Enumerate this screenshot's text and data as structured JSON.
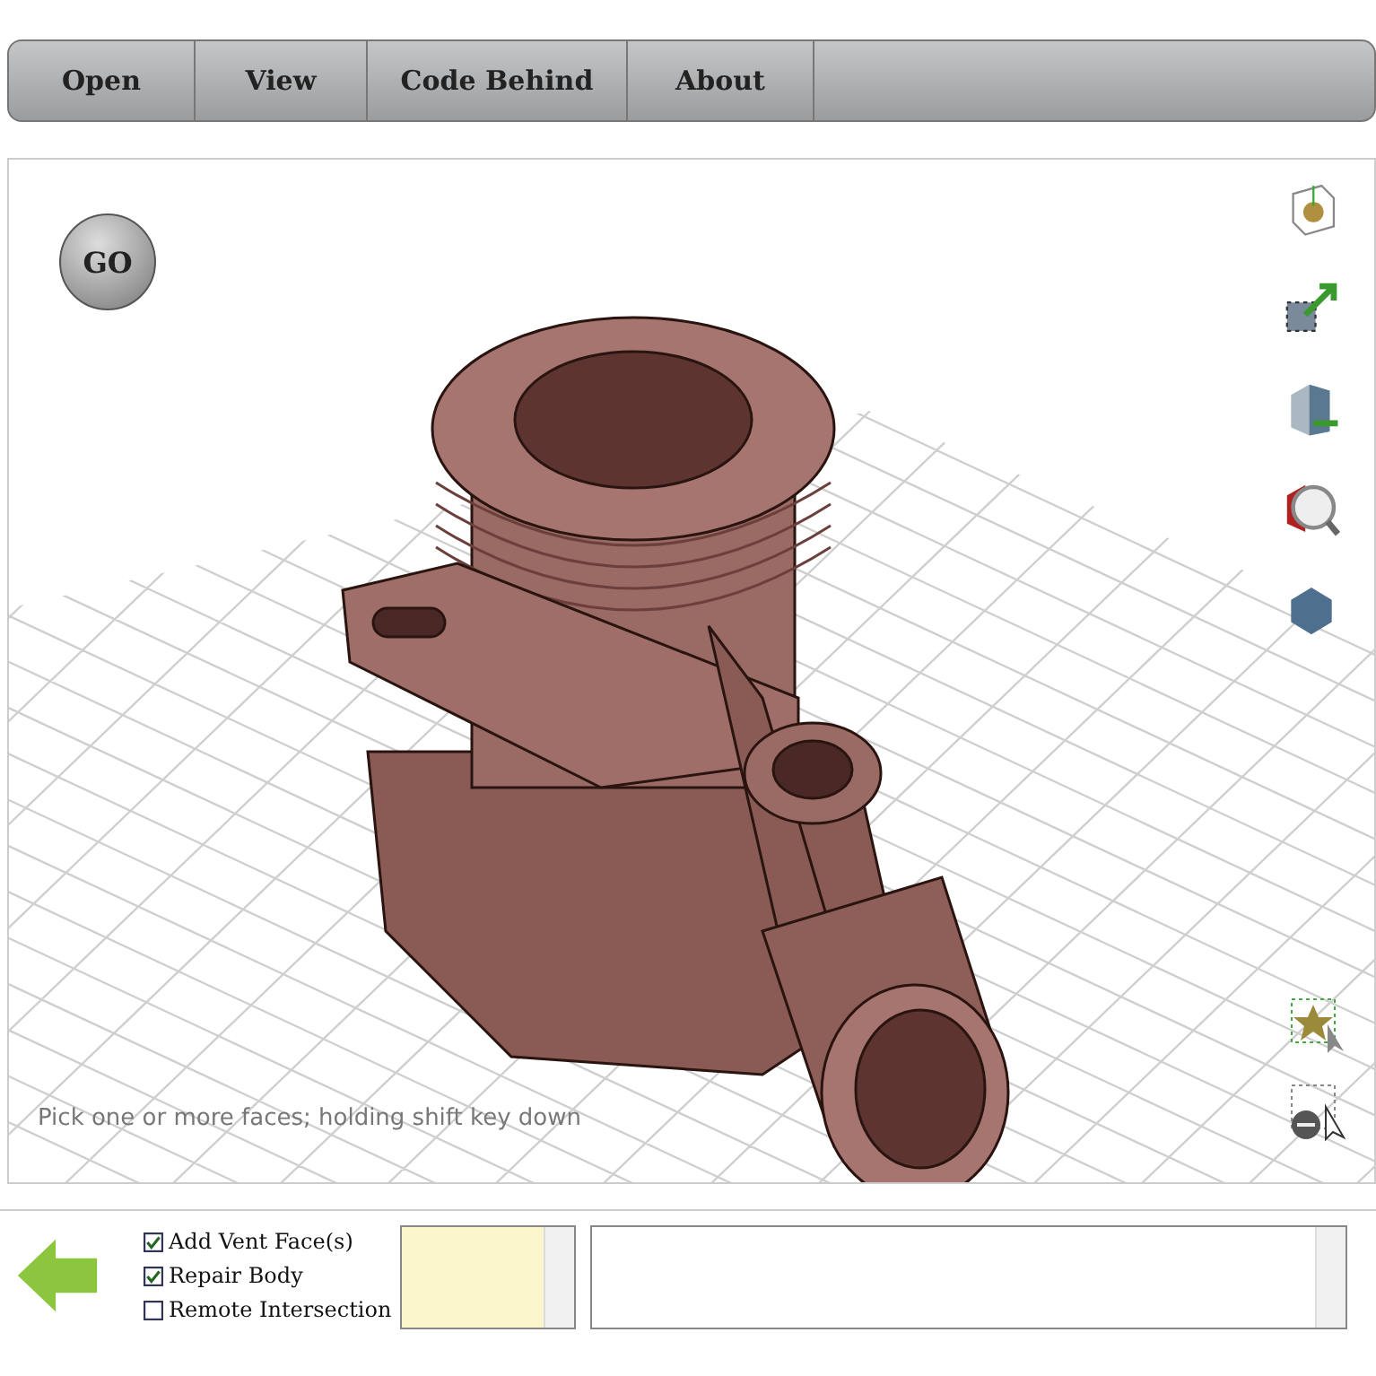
{
  "menu": [
    {
      "label": "Open"
    },
    {
      "label": "View"
    },
    {
      "label": "Code Behind"
    },
    {
      "label": "About"
    }
  ],
  "viewport": {
    "go_button": "GO",
    "hint": "Pick one or more faces; holding shift key down"
  },
  "options": [
    {
      "label": "Add Vent Face(s)",
      "checked": true
    },
    {
      "label": "Repair Body",
      "checked": true
    },
    {
      "label": "Remote Intersection",
      "checked": false
    }
  ]
}
